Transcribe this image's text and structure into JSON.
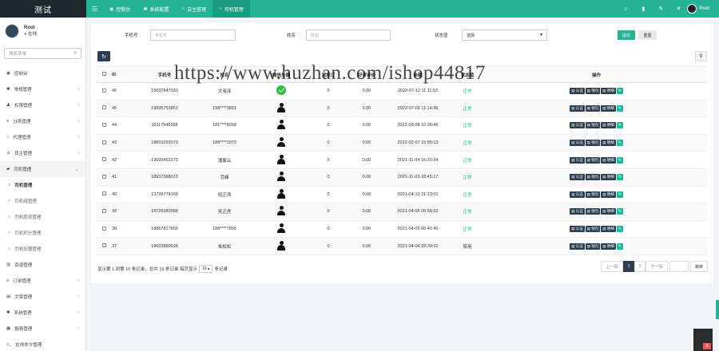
{
  "app": {
    "logo": "测试"
  },
  "topbar": {
    "tabs": [
      {
        "label": "控制台",
        "icon": "dashboard-icon"
      },
      {
        "label": "系统配置",
        "icon": "gear-icon"
      },
      {
        "label": "自主管理",
        "icon": "circle-icon"
      },
      {
        "label": "司机管理",
        "icon": "circle-icon"
      }
    ],
    "user_name": "Root"
  },
  "sidebar": {
    "user": {
      "name": "Root",
      "status": "在线"
    },
    "search_placeholder": "搜索菜单",
    "items": [
      {
        "label": "控制台",
        "icon": "dashboard-icon",
        "chevron": false
      },
      {
        "label": "常规管理",
        "icon": "cogs-icon",
        "chevron": true
      },
      {
        "label": "权限管理",
        "icon": "group-icon",
        "chevron": true
      },
      {
        "label": "分类管理",
        "icon": "list-icon",
        "chevron": true
      },
      {
        "label": "代理管理",
        "icon": "circle-icon",
        "chevron": true
      },
      {
        "label": "货主管理",
        "icon": "user-icon",
        "chevron": true
      },
      {
        "label": "司机管理",
        "icon": "car-icon",
        "chevron": true,
        "open": true
      },
      {
        "label": "司机管理",
        "icon": "circle-icon",
        "sub": true,
        "current": true
      },
      {
        "label": "司机组管理",
        "icon": "circle-icon",
        "sub": true
      },
      {
        "label": "司机提现管理",
        "icon": "circle-icon",
        "sub": true
      },
      {
        "label": "司机积分管理",
        "icon": "circle-icon",
        "sub": true
      },
      {
        "label": "司机加盟管理",
        "icon": "circle-icon",
        "sub": true
      },
      {
        "label": "资源管理",
        "icon": "chart-icon",
        "chevron": false
      },
      {
        "label": "订单管理",
        "icon": "list-icon",
        "chevron": true
      },
      {
        "label": "文章管理",
        "icon": "file-icon",
        "chevron": true
      },
      {
        "label": "系统管理",
        "icon": "gear-icon",
        "chevron": true
      },
      {
        "label": "报表管理",
        "icon": "table-icon",
        "chevron": true
      },
      {
        "label": "在线命令管理",
        "icon": "terminal-icon",
        "chevron": false
      }
    ]
  },
  "filters": {
    "phone_label": "手机号",
    "phone_placeholder": "手机号",
    "name_label": "姓名",
    "name_placeholder": "姓名",
    "status_label": "状态值",
    "status_value": "选择",
    "submit": "提交",
    "reset": "重置"
  },
  "table": {
    "headers": [
      "ID",
      "手机号",
      "姓名",
      "微信头像",
      "完成订",
      "好评评价",
      "余额",
      "注册时间",
      "状态值",
      "操作"
    ],
    "rows": [
      {
        "id": "46",
        "phone": "15037847033",
        "name": "文海泽",
        "avatar": "wechat",
        "orders": "0",
        "rating": "0.00",
        "time": "2022-07-12 11:11:53",
        "status": "正常"
      },
      {
        "id": "45",
        "phone": "19895753851",
        "name": "198****3851",
        "avatar": "person",
        "orders": "0",
        "rating": "0.00",
        "time": "2022-07-06 11:14:49",
        "status": "正常"
      },
      {
        "id": "44",
        "phone": "18117548268",
        "name": "181****8268",
        "avatar": "person",
        "orders": "0",
        "rating": "0.00",
        "time": "2022-03-08 10:25:46",
        "status": "正常"
      },
      {
        "id": "43",
        "phone": "18815292073",
        "name": "188****2073",
        "avatar": "person",
        "orders": "0",
        "rating": "0.00",
        "time": "2022-02-07 15:55:13",
        "status": "正常"
      },
      {
        "id": "42",
        "phone": "13005452273",
        "name": "潘馨云",
        "avatar": "person",
        "orders": "0",
        "rating": "0.00",
        "time": "2021-11-04 15:20:34",
        "status": "正常"
      },
      {
        "id": "41",
        "phone": "18937098013",
        "name": "范峰",
        "avatar": "person",
        "orders": "0",
        "rating": "0.00",
        "time": "2021-11-02 18:43:17",
        "status": "正常"
      },
      {
        "id": "40",
        "phone": "13799774160",
        "name": "倪正涛",
        "avatar": "person",
        "orders": "0",
        "rating": "0.00",
        "time": "2021-04-13 21:13:01",
        "status": "正常"
      },
      {
        "id": "39",
        "phone": "18726580988",
        "name": "吴正虎",
        "avatar": "person",
        "orders": "0",
        "rating": "0.00",
        "time": "2021-04-05 08:56:02",
        "status": "正常"
      },
      {
        "id": "38",
        "phone": "18867817855",
        "name": "188****7855",
        "avatar": "person",
        "orders": "0",
        "rating": "0.00",
        "time": "2021-04-05 06:41:45",
        "status": "正常"
      },
      {
        "id": "37",
        "phone": "18603880926",
        "name": "朱松松",
        "avatar": "person",
        "orders": "0",
        "rating": "0.00",
        "time": "2021-04-04 22:39:32",
        "status": "禁用"
      }
    ],
    "actions": [
      "认证",
      "钱包",
      "明细"
    ]
  },
  "pagination": {
    "info_prefix": "显示第 1 到第 10 条记录，总共 19 条记录 每页显示",
    "page_size": "10",
    "info_suffix": "条记录",
    "prev": "上一页",
    "pages": [
      "1",
      "2"
    ],
    "next": "下一页",
    "go": "跳转"
  },
  "watermark": "https://www.huzhan.com/ishop44817",
  "colors": {
    "brand": "#25b396",
    "dark": "#2c3e50",
    "sidebar_logo": "#1e282c"
  }
}
